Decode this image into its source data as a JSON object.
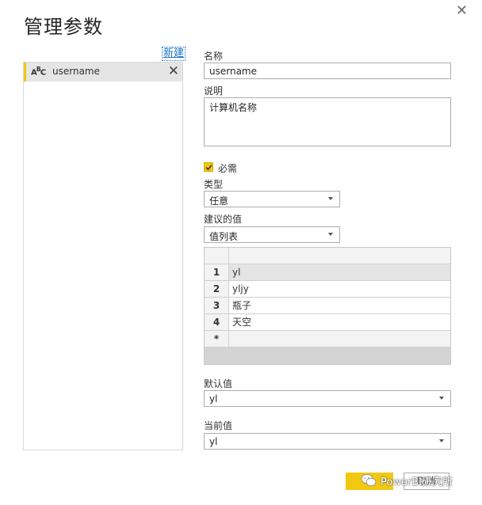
{
  "dialog": {
    "title": "管理参数",
    "new_link": "新建"
  },
  "parameters": [
    {
      "type_icon": "ABC",
      "name": "username"
    }
  ],
  "form": {
    "name_label": "名称",
    "name_value": "username",
    "desc_label": "说明",
    "desc_value": "计算机名称",
    "required_label": "必需",
    "required_checked": true,
    "type_label": "类型",
    "type_value": "任意",
    "suggested_label": "建议的值",
    "suggested_value": "值列表",
    "default_label": "默认值",
    "default_value": "yl",
    "current_label": "当前值",
    "current_value": "yl"
  },
  "value_list": [
    {
      "num": "1",
      "value": "yl"
    },
    {
      "num": "2",
      "value": "yljy"
    },
    {
      "num": "3",
      "value": "瓶子"
    },
    {
      "num": "4",
      "value": "天空"
    },
    {
      "num": "*",
      "value": ""
    }
  ],
  "footer": {
    "cancel_label": "取消",
    "watermark": "PowerBI研究所"
  },
  "colors": {
    "accent": "#f2c811",
    "link": "#1a73c8"
  }
}
